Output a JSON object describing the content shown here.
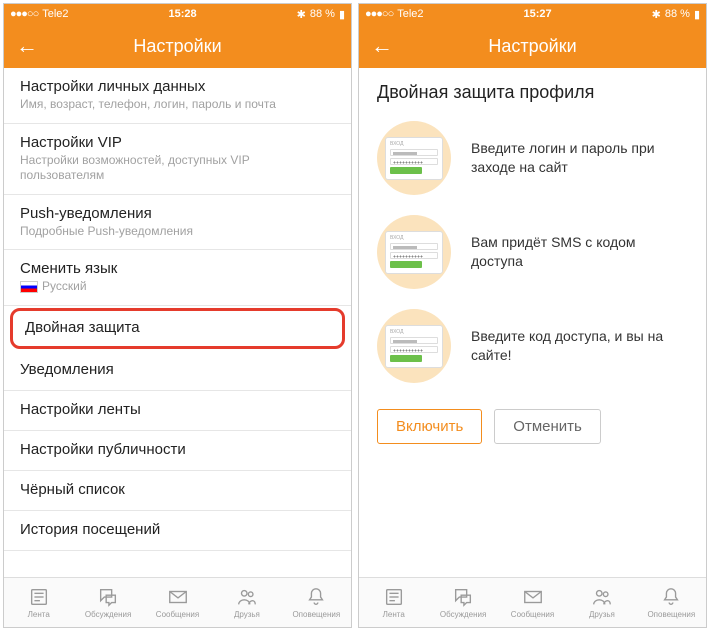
{
  "left": {
    "status": {
      "carrier": "Tele2",
      "time": "15:28",
      "battery": "88 %",
      "signal_dots": "●●●○○",
      "icons": "✈ ⚡ ⋮"
    },
    "nav_title": "Настройки",
    "rows": [
      {
        "title": "Настройки личных данных",
        "sub": "Имя, возраст, телефон, логин, пароль и почта"
      },
      {
        "title": "Настройки VIP",
        "sub": "Настройки возможностей, доступных VIP пользователям"
      },
      {
        "title": "Push-уведомления",
        "sub": "Подробные Push-уведомления"
      },
      {
        "title": "Сменить язык",
        "lang": "Русский"
      },
      {
        "title": "Двойная защита",
        "highlight": true
      },
      {
        "title": "Уведомления"
      },
      {
        "title": "Настройки ленты"
      },
      {
        "title": "Настройки публичности"
      },
      {
        "title": "Чёрный список"
      },
      {
        "title": "История посещений"
      }
    ]
  },
  "right": {
    "status": {
      "carrier": "Tele2",
      "time": "15:27",
      "battery": "88 %",
      "signal_dots": "●●●○○"
    },
    "nav_title": "Настройки",
    "page_title": "Двойная защита профиля",
    "badge_label": "вход",
    "steps": [
      "Введите логин и пароль при заходе на сайт",
      "Вам придёт SMS с кодом доступа",
      "Введите код доступа, и вы на сайте!"
    ],
    "actions": {
      "primary": "Включить",
      "secondary": "Отменить"
    }
  },
  "tabbar": [
    "Лента",
    "Обсуждения",
    "Сообщения",
    "Друзья",
    "Оповещения"
  ]
}
